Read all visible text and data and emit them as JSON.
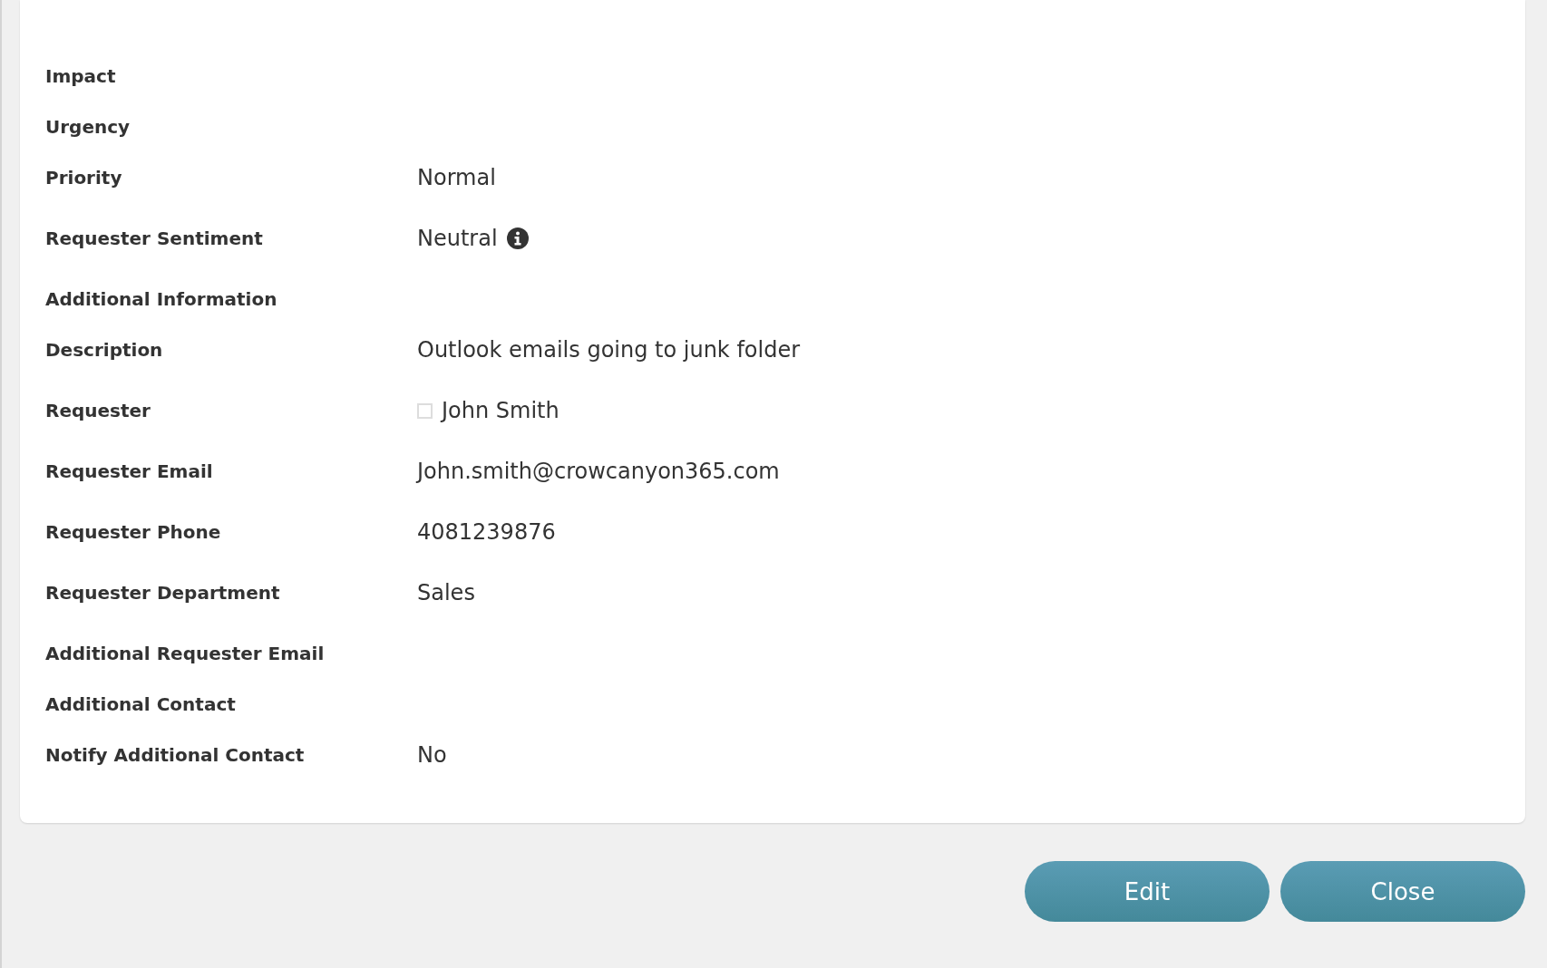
{
  "fields": [
    {
      "label": "Impact",
      "kind": "empty"
    },
    {
      "label": "Urgency",
      "kind": "empty"
    },
    {
      "label": "Priority",
      "kind": "text",
      "value": "Normal"
    },
    {
      "label": "Requester Sentiment",
      "kind": "info",
      "value": "Neutral"
    },
    {
      "label": "Additional Information",
      "kind": "empty"
    },
    {
      "label": "Description",
      "kind": "text",
      "value": "Outlook emails going to junk folder"
    },
    {
      "label": "Requester",
      "kind": "checkbox",
      "value": "John Smith",
      "checked": false
    },
    {
      "label": "Requester Email",
      "kind": "text",
      "value": "John.smith@crowcanyon365.com"
    },
    {
      "label": "Requester Phone",
      "kind": "text",
      "value": "4081239876"
    },
    {
      "label": "Requester Department",
      "kind": "text",
      "value": "Sales"
    },
    {
      "label": "Additional Requester Email",
      "kind": "empty"
    },
    {
      "label": "Additional Contact",
      "kind": "empty"
    },
    {
      "label": "Notify Additional Contact",
      "kind": "text",
      "value": "No"
    }
  ],
  "buttons": [
    "Edit",
    "Close"
  ]
}
